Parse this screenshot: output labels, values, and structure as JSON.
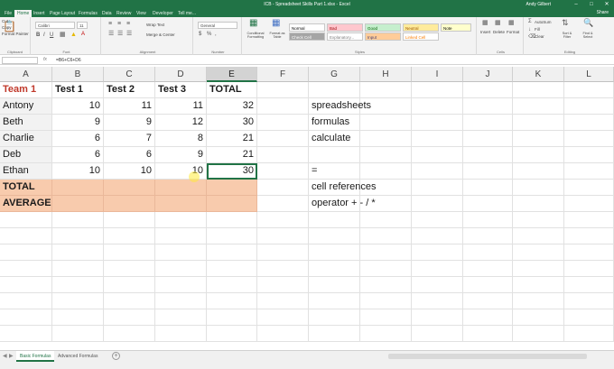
{
  "window": {
    "title": "ICB - Spreadsheet Skills Part 1.xlsx - Excel",
    "user": "Andy Gilbert"
  },
  "ribbon_tabs": [
    "File",
    "Home",
    "Insert",
    "Page Layout",
    "Formulas",
    "Data",
    "Review",
    "View",
    "Developer",
    "Tell me..."
  ],
  "active_tab": "Home",
  "share_label": "Share",
  "ribbon": {
    "clipboard": {
      "cut": "Cut",
      "copy": "Copy",
      "format_painter": "Format Painter",
      "label": "Clipboard"
    },
    "font": {
      "name": "Calibri",
      "size": "11",
      "label": "Font"
    },
    "alignment": {
      "wrap": "Wrap Text",
      "merge": "Merge & Center",
      "label": "Alignment"
    },
    "number": {
      "format": "General",
      "label": "Number"
    },
    "styles": {
      "conditional": "Conditional Formatting",
      "format_table": "Format as Table",
      "cells": [
        {
          "label": "Normal",
          "bg": "#ffffff",
          "fg": "#000000"
        },
        {
          "label": "Bad",
          "bg": "#ffc7ce",
          "fg": "#9c0006"
        },
        {
          "label": "Good",
          "bg": "#c6efce",
          "fg": "#006100"
        },
        {
          "label": "Neutral",
          "bg": "#ffeb9c",
          "fg": "#9c5700"
        },
        {
          "label": "Check Cell",
          "bg": "#a5a5a5",
          "fg": "#ffffff"
        },
        {
          "label": "Explanatory...",
          "bg": "#ffffff",
          "fg": "#7f7f7f"
        },
        {
          "label": "Input",
          "bg": "#ffcc99",
          "fg": "#3f3f76"
        },
        {
          "label": "Linked Cell",
          "bg": "#ffffff",
          "fg": "#fa7d00"
        },
        {
          "label": "Note",
          "bg": "#ffffcc",
          "fg": "#000000"
        }
      ],
      "label": "Styles"
    },
    "cells_group": {
      "insert": "Insert",
      "delete": "Delete",
      "format": "Format",
      "label": "Cells"
    },
    "editing": {
      "autosum": "AutoSum",
      "fill": "Fill",
      "clear": "Clear",
      "sort": "Sort & Filter",
      "find": "Find & Select",
      "label": "Editing"
    }
  },
  "formula_bar": {
    "formula": "=B6+C6+D6"
  },
  "columns": [
    "A",
    "B",
    "C",
    "D",
    "E",
    "F",
    "G",
    "H",
    "I",
    "J",
    "K",
    "L"
  ],
  "rows": [
    [
      "Team 1",
      "Test 1",
      "Test 2",
      "Test 3",
      "TOTAL",
      "",
      "",
      "",
      "",
      "",
      "",
      ""
    ],
    [
      "Antony",
      "10",
      "11",
      "11",
      "32",
      "",
      "spreadsheets",
      "",
      "",
      "",
      "",
      ""
    ],
    [
      "Beth",
      "9",
      "9",
      "12",
      "30",
      "",
      "formulas",
      "",
      "",
      "",
      "",
      ""
    ],
    [
      "Charlie",
      "6",
      "7",
      "8",
      "21",
      "",
      "calculate",
      "",
      "",
      "",
      "",
      ""
    ],
    [
      "Deb",
      "6",
      "6",
      "9",
      "21",
      "",
      "",
      "",
      "",
      "",
      "",
      ""
    ],
    [
      "Ethan",
      "10",
      "10",
      "10",
      "30",
      "",
      "=",
      "",
      "",
      "",
      "",
      ""
    ],
    [
      "TOTAL",
      "",
      "",
      "",
      "",
      "",
      "cell references",
      "",
      "",
      "",
      "",
      ""
    ],
    [
      "AVERAGE",
      "",
      "",
      "",
      "",
      "",
      "operator +  -  /  *",
      "",
      "",
      "",
      "",
      ""
    ]
  ],
  "sheet_tabs": [
    "Basic Formulas",
    "Advanced Formulas"
  ],
  "active_sheet": "Basic Formulas",
  "colors": {
    "excel_green": "#217346",
    "highlight_orange": "#f8cbad",
    "team_red": "#c0392b"
  }
}
